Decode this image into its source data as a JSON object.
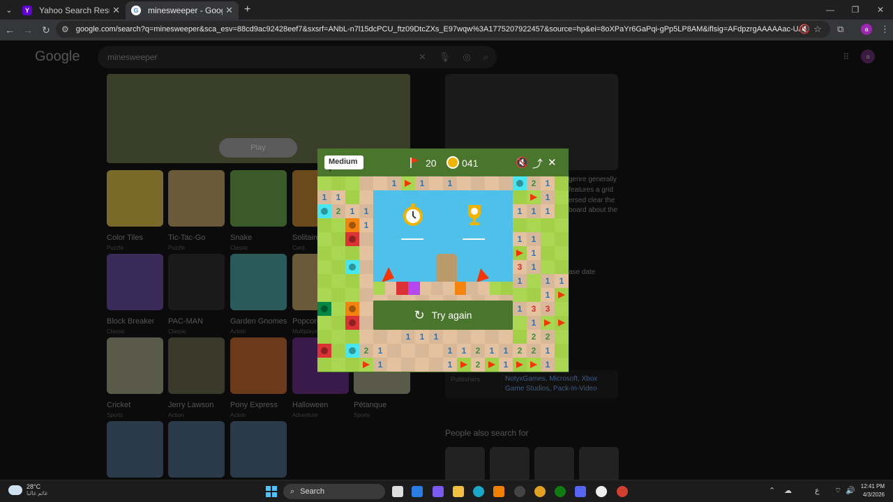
{
  "browser": {
    "tabs": [
      {
        "title": "Yahoo Search Results - فوقل",
        "active": false,
        "favicon_color": "#6001d2",
        "favicon_text": "Y"
      },
      {
        "title": "minesweeper - Google Search",
        "active": true,
        "favicon_color": "#ffffff",
        "favicon_text": "G"
      }
    ],
    "url": "google.com/search?q=minesweeper&sca_esv=88cd9ac92428eef7&sxsrf=ANbL-n7l15dcPCU_ftz09DtcZXs_E97wqw%3A1775207922457&source=hp&ei=8oXPaYr6GaPqi-gPp5LP8AM&iflsig=AFdpzrgAAAAAac-UAg8nIh8cI66cpGSJZJcsN9swO4WT&gs_...",
    "profile_initial": "a"
  },
  "google": {
    "logo": "Google",
    "query": "minesweeper",
    "play_label": "Play",
    "avatar_initial": "a",
    "games": [
      {
        "name": "Color Tiles",
        "category": "Puzzle",
        "color": "#7a6a2a"
      },
      {
        "name": "Tic-Tac-Go",
        "category": "Puzzle",
        "color": "#6a5a3a"
      },
      {
        "name": "Snake",
        "category": "Classic",
        "color": "#3a5a2a"
      },
      {
        "name": "Solitaire",
        "category": "Card",
        "color": "#6a4a1a"
      },
      {
        "name": "Block Breaker",
        "category": "Classic",
        "color": "#3a2a5a"
      },
      {
        "name": "PAC-MAN",
        "category": "Classic",
        "color": "#1a1a1a"
      },
      {
        "name": "Garden Gnomes",
        "category": "Action",
        "color": "#2a5a5a"
      },
      {
        "name": "Popcorn",
        "category": "Multiplayer",
        "color": "#6a5a3a"
      },
      {
        "name": "Cricket",
        "category": "Sports",
        "color": "#5a5a4a"
      },
      {
        "name": "Jerry Lawson",
        "category": "Action",
        "color": "#3a3a2a"
      },
      {
        "name": "Pony Express",
        "category": "Action",
        "color": "#6a3a1a"
      },
      {
        "name": "Halloween",
        "category": "Adventure",
        "color": "#3a1a4a"
      },
      {
        "name": "Pétanque",
        "category": "Sports",
        "color": "#5a5a4a"
      }
    ],
    "knowledge_text": "genre generally features a grid ersed clear the board about the",
    "release_label": "ase date",
    "publishers_label": "Publishers",
    "publishers_value": "NotyxGames, Microsoft, Xbox Game Studios, Pack-In-Video",
    "people_also_search": "People also search for"
  },
  "game": {
    "difficulty": "Medium",
    "flags": "20",
    "time": "041",
    "try_again": "Try again",
    "colors": {
      "header": "#4a752c",
      "light": "#aad751",
      "dark": "#a2d149",
      "rev_light": "#e5c29f",
      "rev_dark": "#d7b899",
      "sky": "#4ec0e9",
      "flag": "#f23607"
    }
  },
  "taskbar": {
    "temperature": "28°C",
    "weather": "غائم غالبا",
    "search_placeholder": "Search",
    "time": "12:41 PM",
    "date": "4/3/2026",
    "lang": "ع"
  }
}
